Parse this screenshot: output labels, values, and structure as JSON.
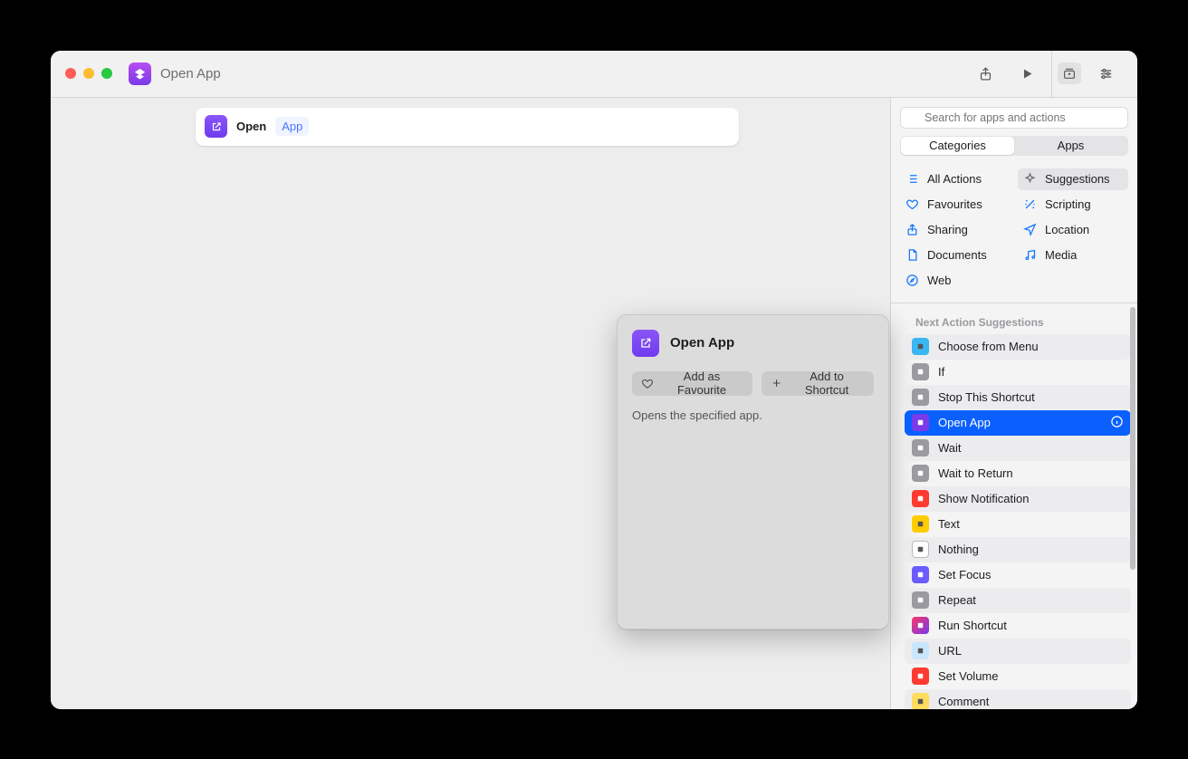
{
  "titlebar": {
    "title": "Open App"
  },
  "action": {
    "open_label": "Open",
    "param_label": "App"
  },
  "popover": {
    "title": "Open App",
    "fav_label": "Add as Favourite",
    "add_label": "Add to Shortcut",
    "description": "Opens the specified app."
  },
  "search": {
    "placeholder": "Search for apps and actions"
  },
  "segmented": {
    "a": "Categories",
    "b": "Apps"
  },
  "categories": {
    "all": "All Actions",
    "sugg": "Suggestions",
    "fav": "Favourites",
    "script": "Scripting",
    "share": "Sharing",
    "loc": "Location",
    "docs": "Documents",
    "media": "Media",
    "web": "Web"
  },
  "suggestions": {
    "header": "Next Action Suggestions",
    "items": [
      {
        "label": "Choose from Menu",
        "color": "#3ab7f3",
        "alt": true
      },
      {
        "label": "If",
        "color": "#9a9aa0",
        "alt": false
      },
      {
        "label": "Stop This Shortcut",
        "color": "#9a9aa0",
        "alt": true
      },
      {
        "label": "Open App",
        "color": "#7a3ae9",
        "alt": false,
        "selected": true
      },
      {
        "label": "Wait",
        "color": "#9a9aa0",
        "alt": true
      },
      {
        "label": "Wait to Return",
        "color": "#9a9aa0",
        "alt": false
      },
      {
        "label": "Show Notification",
        "color": "#ff3a30",
        "alt": true
      },
      {
        "label": "Text",
        "color": "#ffcc00",
        "alt": false
      },
      {
        "label": "Nothing",
        "color": "#ffffff",
        "alt": true,
        "border": true
      },
      {
        "label": "Set Focus",
        "color": "#6a5cff",
        "alt": false
      },
      {
        "label": "Repeat",
        "color": "#9a9aa0",
        "alt": true
      },
      {
        "label": "Run Shortcut",
        "color": "#ff3465",
        "alt": false,
        "grad": true
      },
      {
        "label": "URL",
        "color": "#c9e6ff",
        "alt": true
      },
      {
        "label": "Set Volume",
        "color": "#ff3a30",
        "alt": false
      },
      {
        "label": "Comment",
        "color": "#ffdc5e",
        "alt": true
      }
    ]
  }
}
